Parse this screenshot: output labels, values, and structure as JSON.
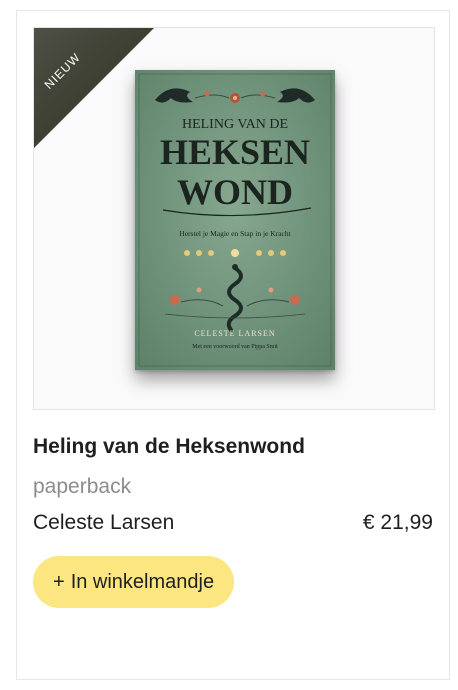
{
  "product": {
    "badge": "NIEUW",
    "title": "Heling van de Heksenwond",
    "format": "paperback",
    "author": "Celeste Larsen",
    "price": "€ 21,99",
    "cart_button": {
      "icon": "+",
      "label": "In winkelmandje"
    }
  },
  "cover": {
    "title_line1": "HELING VAN DE",
    "title_line2": "HEKSEN",
    "title_line3": "WOND",
    "subtitle": "Herstel je Magie en Stap in je Kracht",
    "author": "CELESTE LARSEN",
    "foreword": "Met een voorwoord van Pippa Smit",
    "background_color": "#6e9179",
    "ink_color": "#1c2420"
  },
  "colors": {
    "badge": "#3a3c30",
    "button": "#fbe681",
    "title_text": "#1f1f1f",
    "muted_text": "#8c8c8c"
  }
}
